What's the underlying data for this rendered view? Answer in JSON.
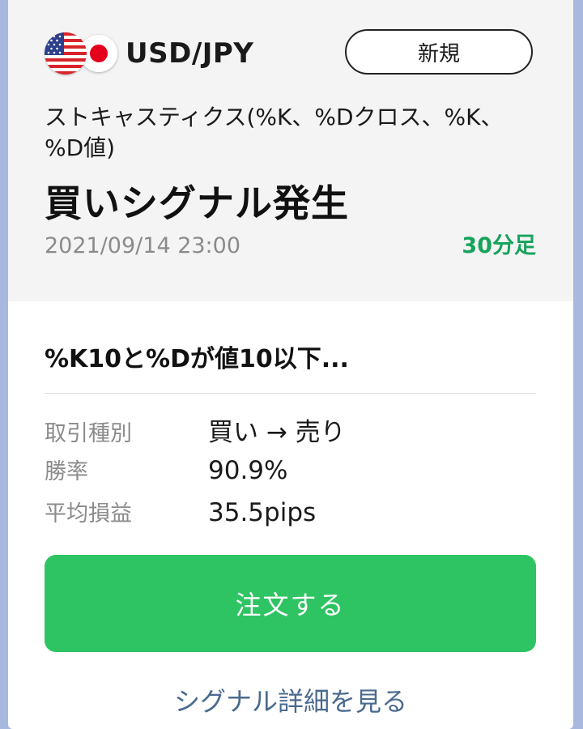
{
  "pair": {
    "label": "USD/JPY",
    "base_flag": "us-flag-icon",
    "quote_flag": "jp-flag-icon"
  },
  "header": {
    "new_button_label": "新規",
    "indicator": "ストキャスティクス(%K、%Dクロス、%K、%D値)",
    "headline": "買いシグナル発生",
    "datetime": "2021/09/14 23:00",
    "timeframe": "30分足"
  },
  "body": {
    "condition": "%K10と%Dが値10以下...",
    "stats": [
      {
        "label": "取引種別",
        "value": "買い → 売り"
      },
      {
        "label": "勝率",
        "value": "90.9%"
      },
      {
        "label": "平均損益",
        "value": "35.5pips"
      }
    ],
    "order_button_label": "注文する",
    "detail_link_label": "シグナル詳細を見る"
  },
  "colors": {
    "accent_green": "#2fc463",
    "timeframe_green": "#17a35b",
    "link_blue": "#4a6a8e",
    "background": "#a9b8df"
  }
}
